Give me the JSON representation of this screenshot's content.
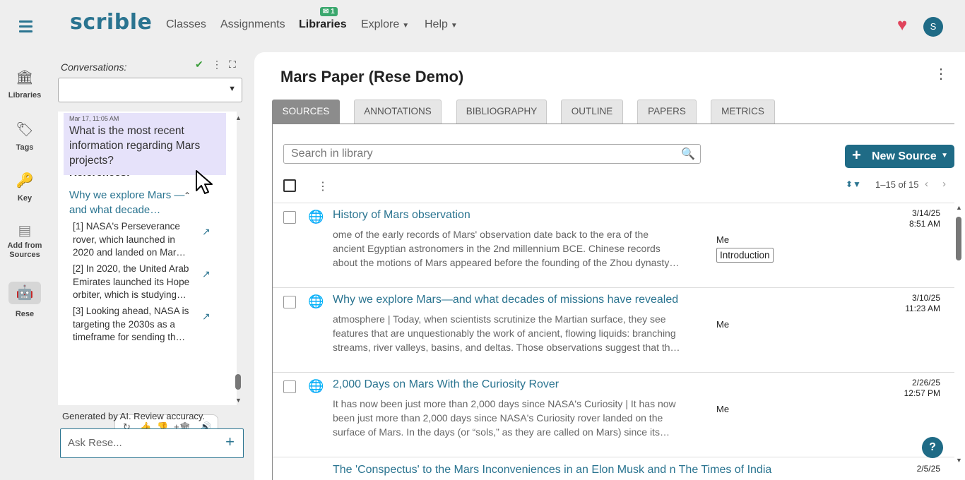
{
  "nav": {
    "logo": "scrible",
    "links": [
      "Classes",
      "Assignments",
      "Libraries",
      "Explore",
      "Help"
    ],
    "assignments_badge": "1",
    "avatar_initial": "S"
  },
  "rail": {
    "items": [
      "Libraries",
      "Tags",
      "Key",
      "Add from Sources",
      "Rese"
    ]
  },
  "conversation": {
    "label": "Conversations:",
    "timestamp": "Mar 17, 11:05 AM",
    "question": "What is the most recent information regarding Mars projects?",
    "references_heading": "References:",
    "reference_title": "Why we explore Mars —and what decade…",
    "references": [
      "[1] NASA's Perseverance rover, which launched in 2020 and landed on Mar…",
      "[2] In 2020, the United Arab Emirates launched its Hope orbiter, which is studying…",
      "[3] Looking ahead, NASA is targeting the 2030s as a timeframe for sending th…"
    ],
    "disclaimer": "Generated by AI. Review accuracy.",
    "ask_placeholder": "Ask Rese..."
  },
  "main": {
    "title": "Mars Paper (Rese Demo)",
    "tabs": [
      "SOURCES",
      "ANNOTATIONS",
      "BIBLIOGRAPHY",
      "OUTLINE",
      "PAPERS",
      "METRICS"
    ],
    "active_tab": "SOURCES",
    "search_placeholder": "Search in library",
    "new_source_label": "New Source",
    "pagination": "1–15 of 15",
    "sources": [
      {
        "title": "History of Mars observation",
        "excerpt": "ome of the early records of Mars' observation date back to the era of the ancient Egyptian astronomers in the 2nd millennium BCE. Chinese records about the motions of Mars appeared before the founding of the Zhou dynasty…",
        "owner": "Me",
        "tag": "Introduction",
        "date": "3/14/25",
        "time": "8:51 AM"
      },
      {
        "title": "Why we explore Mars—and what decades of missions have revealed",
        "excerpt": "atmosphere | Today, when scientists scrutinize the Martian surface, they see features that are unquestionably the work of ancient, flowing liquids: branching streams, river valleys, basins, and deltas. Those observations suggest that th…",
        "owner": "Me",
        "tag": "",
        "date": "3/10/25",
        "time": "11:23 AM"
      },
      {
        "title": "2,000 Days on Mars With the Curiosity Rover",
        "excerpt": "It has now been just more than 2,000 days since NASA's Curiosity | It has now been just more than 2,000 days since NASA's Curiosity rover landed on the surface of Mars. In the days (or “sols,” as they are called on Mars) since its…",
        "owner": "Me",
        "tag": "",
        "date": "2/26/25",
        "time": "12:57 PM"
      }
    ],
    "partial_row": {
      "title": "The 'Conspectus' to the Mars Inconveniences in an Elon Musk and n The Times of India",
      "date": "2/5/25"
    },
    "help_label": "?"
  },
  "colors": {
    "brand": "#2a7490",
    "primary_button": "#1f6b86",
    "heart": "#e0445c",
    "bubble": "#e6e2fa",
    "badge": "#3aa76d"
  }
}
